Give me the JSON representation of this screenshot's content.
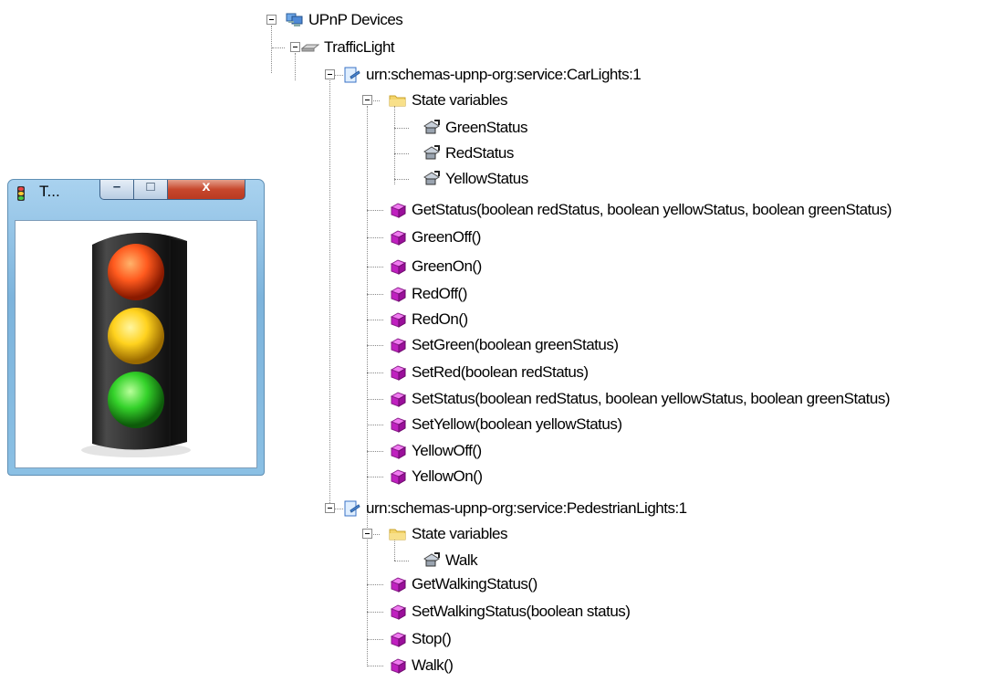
{
  "window": {
    "title": "T...",
    "minimize_glyph": "–",
    "maximize_glyph": "□",
    "close_glyph": "x",
    "lights": {
      "red": "on",
      "yellow": "on",
      "green": "on"
    }
  },
  "tree": [
    {
      "name": "upnp-devices-node",
      "label": "UPnP Devices",
      "icon": "network-computer-icon",
      "expander": true
    },
    {
      "name": "device-trafficlight-node",
      "label": "TrafficLight",
      "icon": "device-icon",
      "expander": true
    },
    {
      "name": "service-carlights-node",
      "label": "urn:schemas-upnp-org:service:CarLights:1",
      "icon": "service-icon",
      "expander": true
    },
    {
      "name": "state-variables-folder",
      "label": "State variables",
      "icon": "folder-icon",
      "expander": true
    },
    {
      "name": "statevar-greenstatus",
      "label": "GreenStatus",
      "icon": "state-variable-icon"
    },
    {
      "name": "statevar-redstatus",
      "label": "RedStatus",
      "icon": "state-variable-icon"
    },
    {
      "name": "statevar-yellowstatus",
      "label": "YellowStatus",
      "icon": "state-variable-icon"
    },
    {
      "name": "action-getstatus",
      "label": "GetStatus(boolean redStatus, boolean yellowStatus, boolean greenStatus)",
      "icon": "action-cube-icon"
    },
    {
      "name": "action-greenoff",
      "label": "GreenOff()",
      "icon": "action-cube-icon"
    },
    {
      "name": "action-greenon",
      "label": "GreenOn()",
      "icon": "action-cube-icon"
    },
    {
      "name": "action-redoff",
      "label": "RedOff()",
      "icon": "action-cube-icon"
    },
    {
      "name": "action-redon",
      "label": "RedOn()",
      "icon": "action-cube-icon"
    },
    {
      "name": "action-setgreen",
      "label": "SetGreen(boolean greenStatus)",
      "icon": "action-cube-icon"
    },
    {
      "name": "action-setred",
      "label": "SetRed(boolean redStatus)",
      "icon": "action-cube-icon"
    },
    {
      "name": "action-setstatus",
      "label": "SetStatus(boolean redStatus, boolean yellowStatus, boolean greenStatus)",
      "icon": "action-cube-icon"
    },
    {
      "name": "action-setyellow",
      "label": "SetYellow(boolean yellowStatus)",
      "icon": "action-cube-icon"
    },
    {
      "name": "action-yellowoff",
      "label": "YellowOff()",
      "icon": "action-cube-icon"
    },
    {
      "name": "action-yellowon",
      "label": "YellowOn()",
      "icon": "action-cube-icon"
    },
    {
      "name": "service-pedestrianlights-node",
      "label": "urn:schemas-upnp-org:service:PedestrianLights:1",
      "icon": "service-icon",
      "expander": true
    },
    {
      "name": "state-variables-folder-2",
      "label": "State variables",
      "icon": "folder-icon",
      "expander": true
    },
    {
      "name": "statevar-walk",
      "label": "Walk",
      "icon": "state-variable-icon"
    },
    {
      "name": "action-getwalkingstatus",
      "label": "GetWalkingStatus()",
      "icon": "action-cube-icon"
    },
    {
      "name": "action-setwalkingstatus",
      "label": "SetWalkingStatus(boolean status)",
      "icon": "action-cube-icon"
    },
    {
      "name": "action-stop",
      "label": "Stop()",
      "icon": "action-cube-icon"
    },
    {
      "name": "action-walk",
      "label": "Walk()",
      "icon": "action-cube-icon"
    }
  ]
}
